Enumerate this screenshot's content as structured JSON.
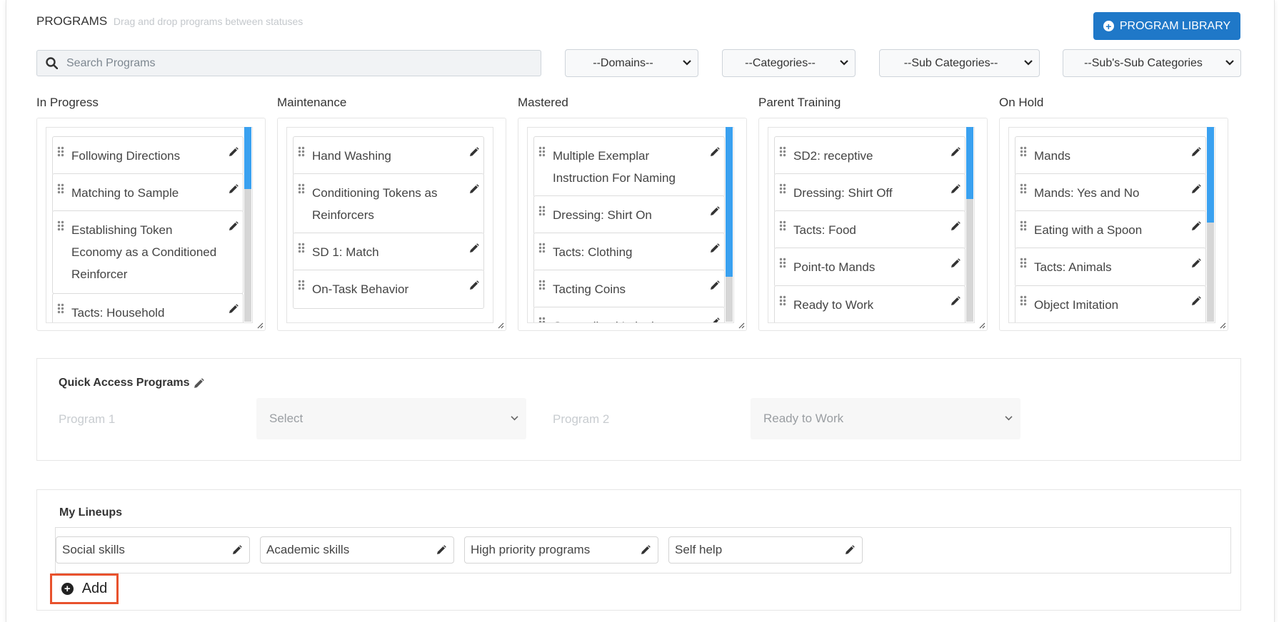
{
  "header": {
    "title": "PROGRAMS",
    "hint": "Drag and drop programs between statuses",
    "library_button": "PROGRAM LIBRARY"
  },
  "search": {
    "placeholder": "Search Programs"
  },
  "filters": {
    "domains": "--Domains--",
    "categories": "--Categories--",
    "sub_categories": "--Sub Categories--",
    "subs_sub_categories": "--Sub's-Sub Categories"
  },
  "columns": [
    {
      "title": "In Progress",
      "items": [
        "Following Directions",
        "Matching to Sample",
        "Establishing Token Economy as a Conditioned Reinforcer",
        "Tacts: Household"
      ],
      "scroll": 0.32
    },
    {
      "title": "Maintenance",
      "items": [
        "Hand Washing",
        "Conditioning Tokens as Reinforcers",
        "SD 1: Match",
        "On-Task Behavior"
      ],
      "scroll": null
    },
    {
      "title": "Mastered",
      "items": [
        "Multiple Exemplar Instruction For Naming",
        "Dressing: Shirt On",
        "Tacts: Clothing",
        "Tacting Coins",
        "Generalized Imitation"
      ],
      "scroll": 0.77
    },
    {
      "title": "Parent Training",
      "items": [
        "SD2: receptive",
        "Dressing: Shirt Off",
        "Tacts: Food",
        "Point-to Mands",
        "Ready to Work"
      ],
      "scroll": 0.37
    },
    {
      "title": "On Hold",
      "items": [
        "Mands",
        "Mands: Yes and No",
        "Eating with a Spoon",
        "Tacts: Animals",
        "Object Imitation"
      ],
      "scroll": 0.49
    }
  ],
  "quick_access": {
    "title": "Quick Access Programs",
    "program1_label": "Program 1",
    "program1_value": "Select",
    "program2_label": "Program 2",
    "program2_value": "Ready to Work"
  },
  "lineups": {
    "title": "My Lineups",
    "items": [
      "Social skills",
      "Academic skills",
      "High priority programs",
      "Self help"
    ],
    "add_label": "Add"
  },
  "colors": {
    "primary": "#1f78c8",
    "scroll_thumb": "#3aa1f0",
    "highlight": "#e8522d"
  }
}
